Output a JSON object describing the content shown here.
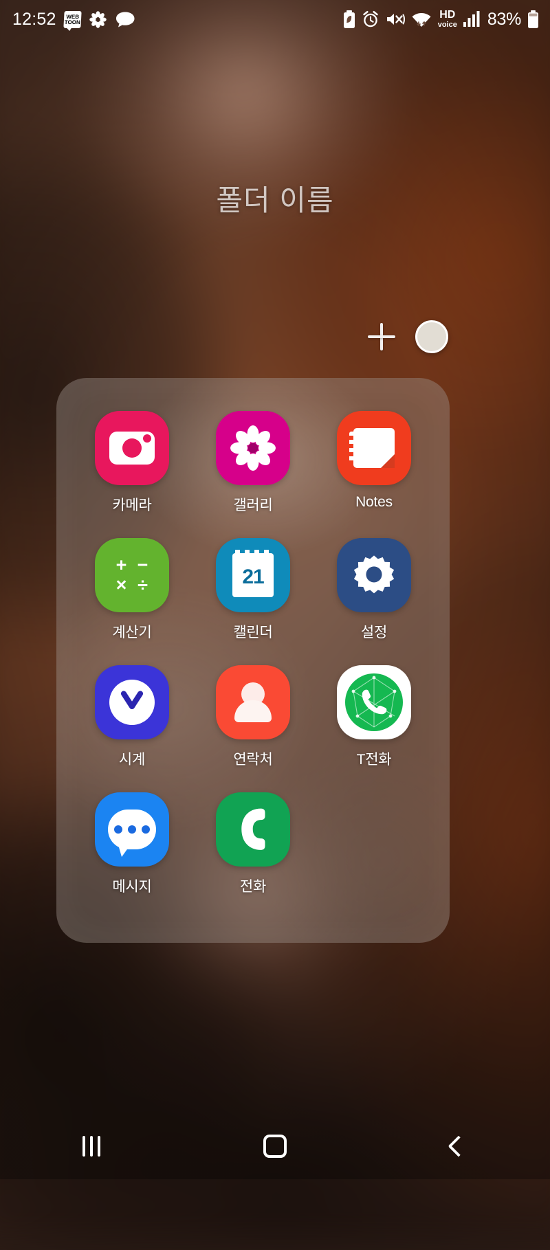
{
  "status_bar": {
    "clock": "12:52",
    "battery_percent": "83%",
    "left_icons": [
      {
        "name": "webtoon-icon",
        "label_top": "WEB",
        "label_bottom": "TOON"
      },
      {
        "name": "gallery-notification-icon",
        "label": "flower"
      },
      {
        "name": "kakao-chat-icon",
        "label": "speech-bubble"
      }
    ],
    "right_icons": [
      {
        "name": "battery-saver-icon"
      },
      {
        "name": "alarm-icon"
      },
      {
        "name": "mute-vibrate-icon"
      },
      {
        "name": "wifi-icon"
      },
      {
        "name": "hd-voice-icon",
        "line1": "HD",
        "line2": "voice"
      },
      {
        "name": "cellular-signal-icon"
      },
      {
        "name": "battery-icon"
      }
    ]
  },
  "folder": {
    "title": "폴더 이름",
    "add_label": "+",
    "color_swatch": "#e2ddd4",
    "panel_color": "rgba(150,138,130,0.42)",
    "apps": [
      {
        "label": "카메라",
        "icon": "camera-icon",
        "bg": "#e8175d",
        "fg": "#ffffff"
      },
      {
        "label": "갤러리",
        "icon": "gallery-icon",
        "bg": "#d6008a",
        "fg": "#ffffff"
      },
      {
        "label": "Notes",
        "icon": "notes-icon",
        "bg": "#f03c1e",
        "fg": "#ffffff"
      },
      {
        "label": "계산기",
        "icon": "calculator-icon",
        "bg": "#63b32e",
        "fg": "#ffffff"
      },
      {
        "label": "캘린더",
        "icon": "calendar-icon",
        "bg": "#0f8bba",
        "fg": "#ffffff",
        "day": "21"
      },
      {
        "label": "설정",
        "icon": "settings-gear-icon",
        "bg": "#2c4d85",
        "fg": "#ffffff"
      },
      {
        "label": "시계",
        "icon": "clock-icon",
        "bg": "#3b34d8",
        "fg": "#ffffff"
      },
      {
        "label": "연락처",
        "icon": "contacts-icon",
        "bg": "#fa4a34",
        "fg": "#ffffff"
      },
      {
        "label": "T전화",
        "icon": "t-phone-icon",
        "bg": "#ffffff",
        "fg": "#15b851"
      },
      {
        "label": "메시지",
        "icon": "messages-icon",
        "bg": "#1b84f2",
        "fg": "#ffffff"
      },
      {
        "label": "전화",
        "icon": "phone-icon",
        "bg": "#11a353",
        "fg": "#ffffff"
      }
    ]
  },
  "nav_bar": {
    "recents_label": "|||",
    "home_label": "home",
    "back_label": "<"
  }
}
